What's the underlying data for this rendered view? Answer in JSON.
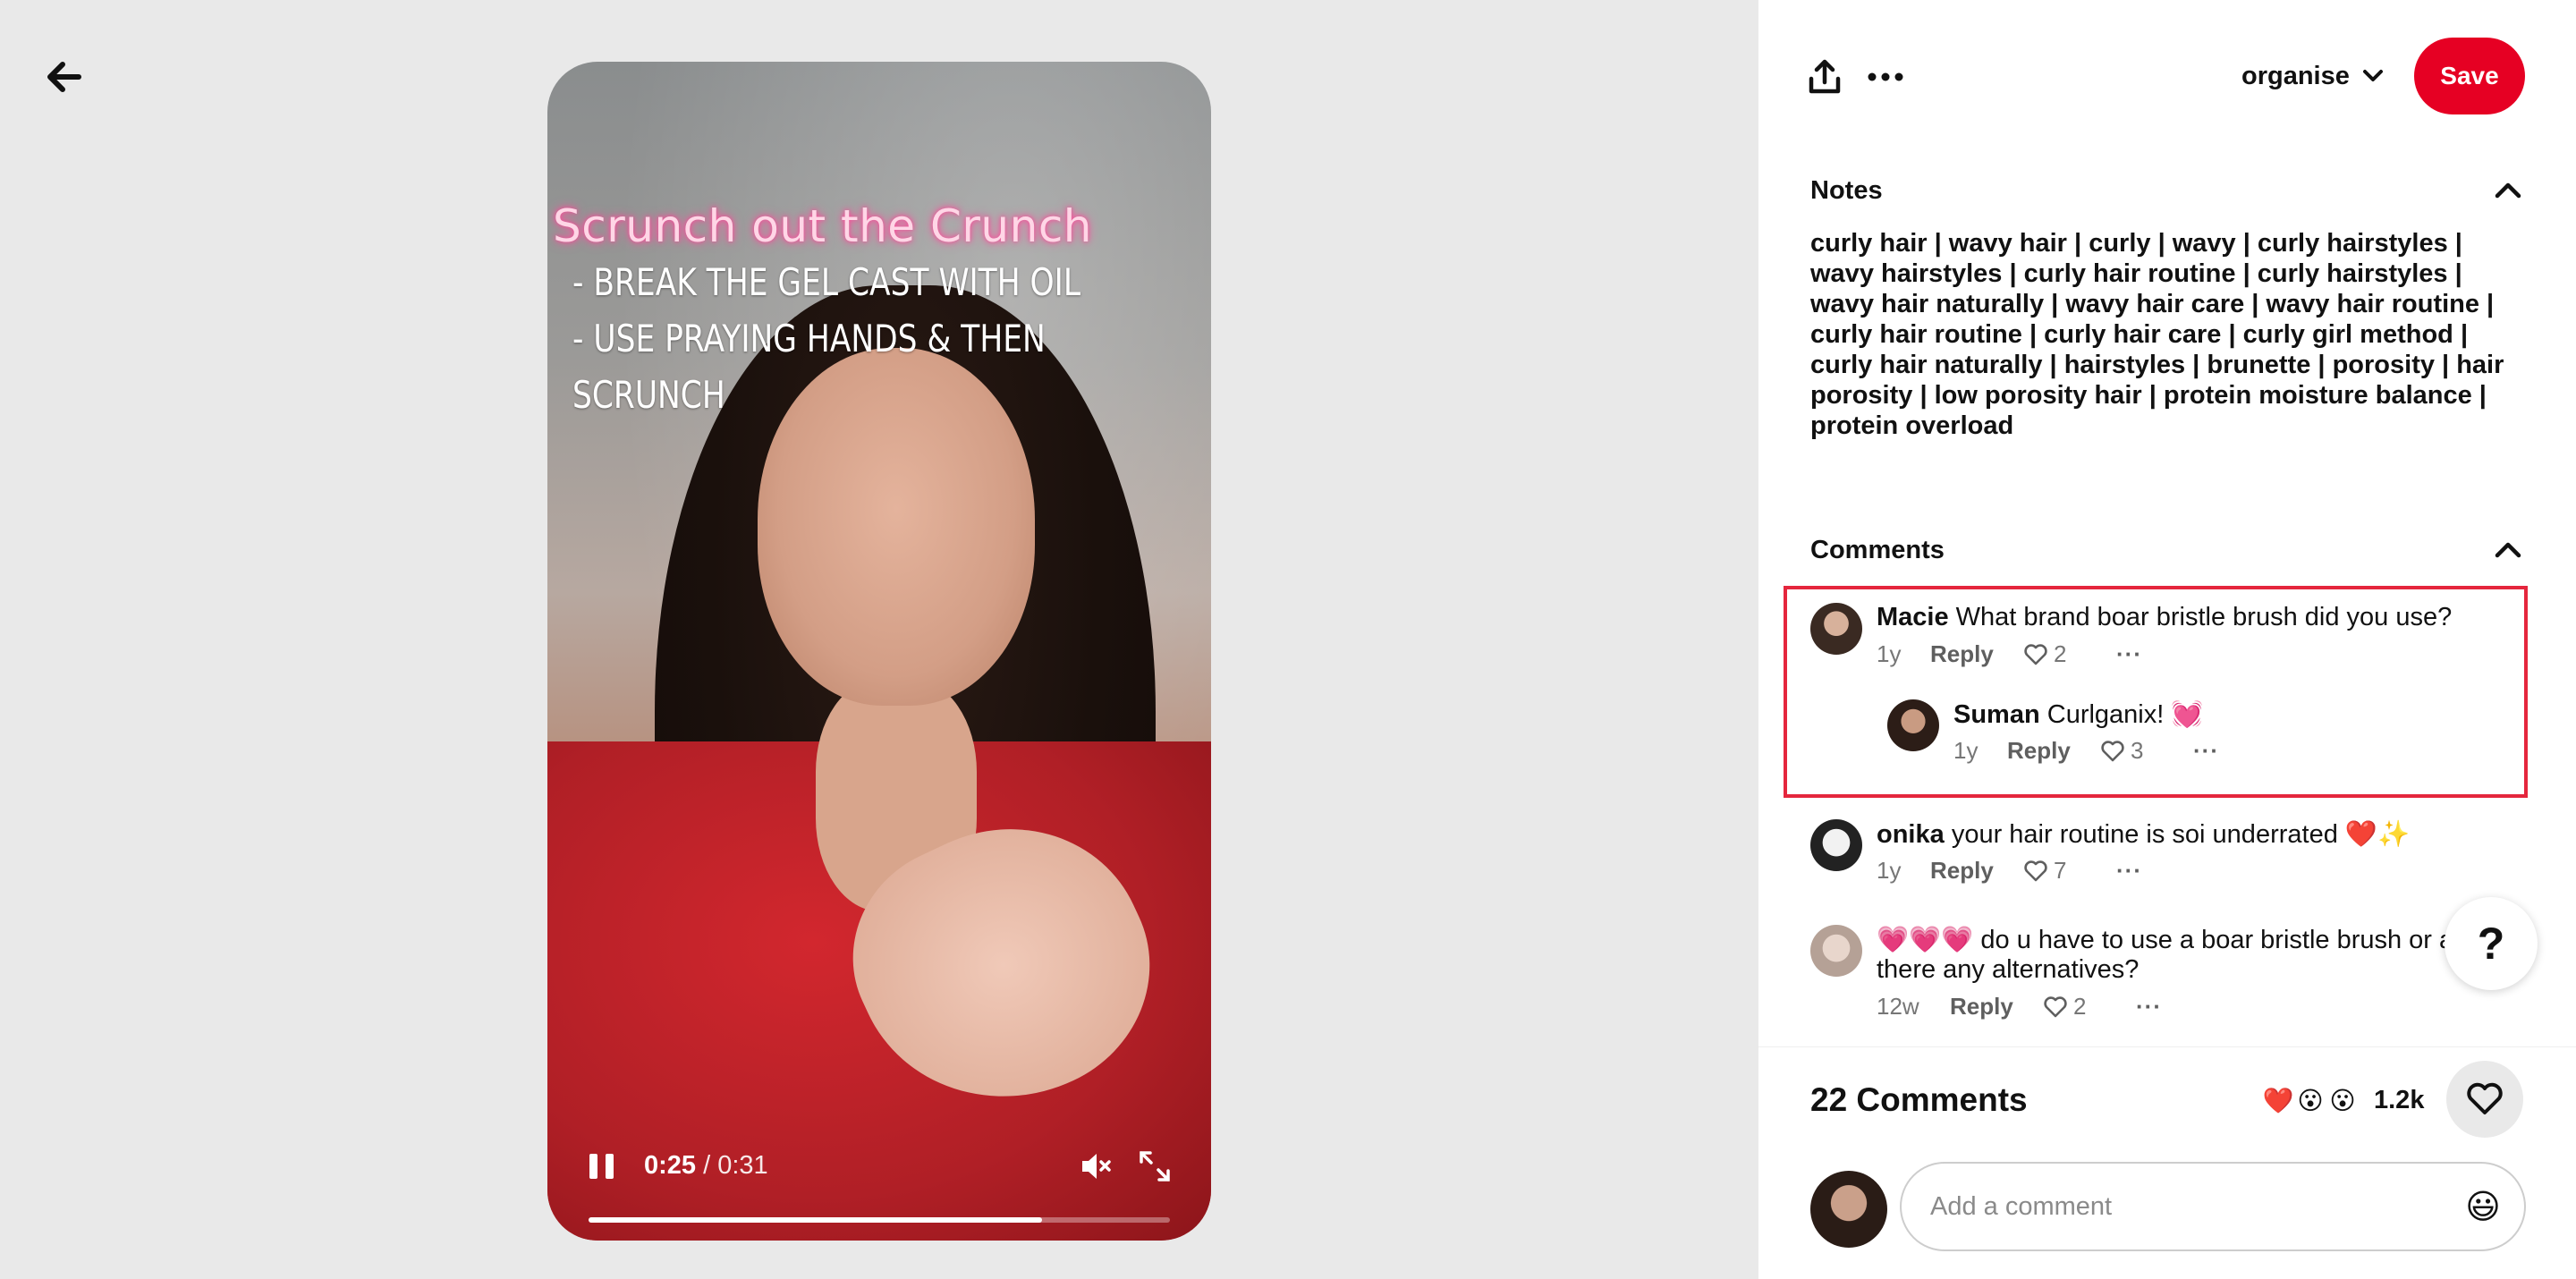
{
  "video": {
    "overlay_title": "Scrunch out the Crunch",
    "overlay_lines": [
      "- BREAK THE GEL CAST WITH OIL",
      "- USE PRAYING HANDS & THEN",
      "SCRUNCH"
    ],
    "current_time": "0:25",
    "separator": "/",
    "duration": "0:31",
    "progress": 0.78
  },
  "topbar": {
    "board_name": "organise",
    "save_label": "Save"
  },
  "notes": {
    "title": "Notes",
    "text": "curly hair | wavy hair | curly | wavy | curly hairstyles | wavy hairstyles | curly hair routine | curly hairstyles | wavy hair naturally | wavy hair care | wavy hair routine | curly hair routine | curly hair care | curly girl method | curly hair naturally | hairstyles | brunette | porosity | hair porosity | low porosity hair | protein moisture balance | protein overload"
  },
  "comments": {
    "title": "Comments",
    "items": [
      {
        "author": "Macie",
        "text": "What brand boar bristle brush did you use?",
        "time": "1y",
        "reply": "Reply",
        "likes": "2",
        "more": "···"
      },
      {
        "author": "Suman",
        "text": "Curlganix! 💓",
        "time": "1y",
        "reply": "Reply",
        "likes": "3",
        "more": "···"
      },
      {
        "author": "onika",
        "text": "your hair routine is soi underrated ❤️✨",
        "time": "1y",
        "reply": "Reply",
        "likes": "7",
        "more": "···"
      },
      {
        "author": "",
        "text_line1": "💗💗💗 do u have to use a boar bristle brush or are",
        "text_line2": "there any alternatives?",
        "time": "12w",
        "reply": "Reply",
        "likes": "2",
        "more": "···"
      }
    ]
  },
  "help": {
    "label": "?"
  },
  "footer": {
    "count_label": "22 Comments",
    "reactions": [
      "❤️",
      "😮",
      "😮"
    ],
    "reaction_count": "1.2k",
    "input_placeholder": "Add a comment",
    "emoji_icon": "😃"
  },
  "colors": {
    "save_red": "#e60023",
    "highlight_red": "#e5263d",
    "media_bg": "#e9e9e9"
  },
  "icons": [
    "back-arrow-icon",
    "share-icon",
    "more-icon",
    "chevron-down-icon",
    "chevron-up-icon",
    "pause-icon",
    "mute-icon",
    "fullscreen-icon",
    "heart-icon",
    "help-icon",
    "emoji-icon"
  ]
}
